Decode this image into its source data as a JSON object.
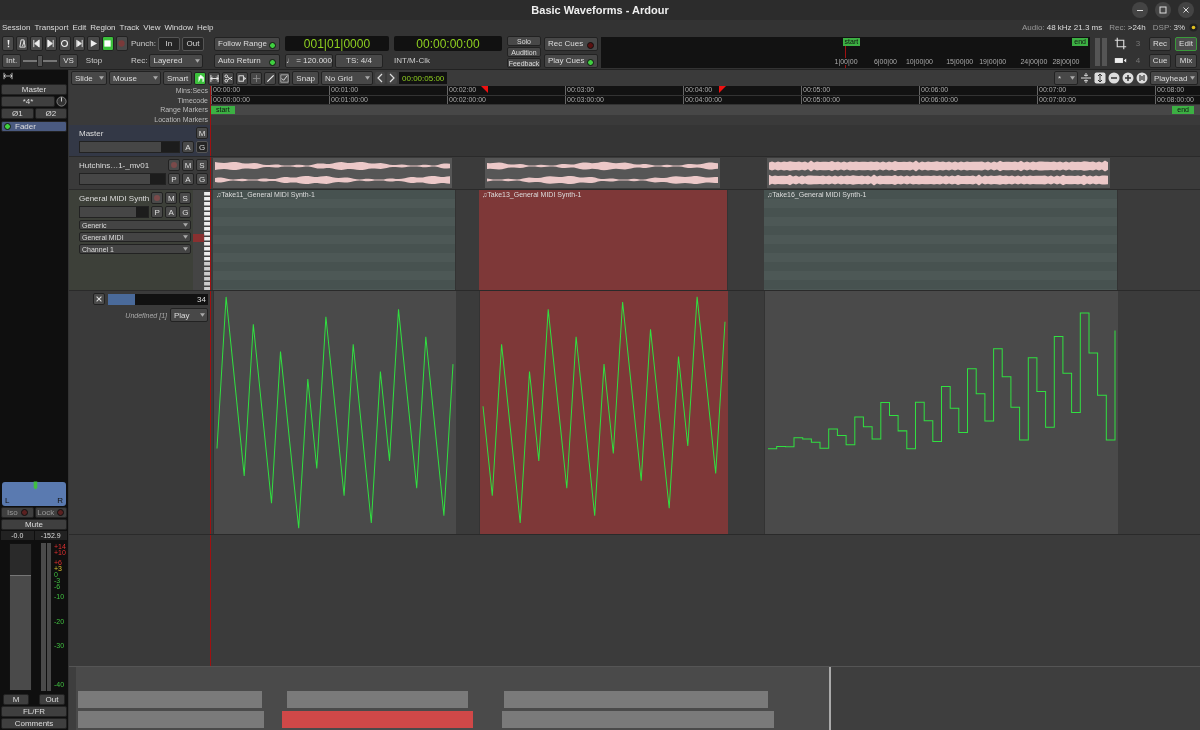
{
  "window": {
    "title": "Basic Waveforms - Ardour"
  },
  "menu": [
    "Session",
    "Transport",
    "Edit",
    "Region",
    "Track",
    "View",
    "Window",
    "Help"
  ],
  "status": [
    {
      "label": "Audio:",
      "value": "48 kHz 21.3 ms"
    },
    {
      "label": "Rec:",
      "value": ">24h"
    },
    {
      "label": "DSP:",
      "value": "3%"
    }
  ],
  "transport": {
    "buttons": [
      {
        "kind": "alert",
        "on": false
      },
      {
        "kind": "metronome",
        "on": false
      },
      {
        "kind": "start",
        "on": false
      },
      {
        "kind": "end",
        "on": false
      },
      {
        "kind": "loop",
        "on": false
      },
      {
        "kind": "range",
        "on": false
      },
      {
        "kind": "play",
        "on": false
      },
      {
        "kind": "stop",
        "on": true
      },
      {
        "kind": "record",
        "on": false
      }
    ],
    "punch_label": "Punch:",
    "punch": [
      {
        "label": "In",
        "disabled": true
      },
      {
        "label": "Out",
        "disabled": true
      }
    ],
    "int_button": "Int.",
    "shuttle": {
      "level": 0.5
    },
    "vs_button": "VS",
    "state": "Stop",
    "rec_label": "Rec:",
    "rec_mode": "Layered",
    "follow": [
      {
        "label": "Follow Range",
        "on": true
      },
      {
        "label": "Auto Return",
        "on": true
      }
    ],
    "primary_clock": "001|01|0000",
    "secondary_clock": "00:00:00:00",
    "tempo": "♩ = 120.000",
    "meter": "TS: 4/4",
    "sync": "INT/M-Clk",
    "monitor": [
      "Solo",
      "Audition",
      "Feedback"
    ],
    "cues": [
      {
        "label": "Rec Cues",
        "on": false
      },
      {
        "label": "Play Cues",
        "on": true
      }
    ],
    "mini_timeline": {
      "markers": [
        "start",
        "end"
      ],
      "ticks": [
        "1|00|00",
        "6|00|00",
        "10|00|00",
        "15|00|00",
        "19|00|00",
        "24|00|00",
        "28|00|00"
      ]
    },
    "counts": [
      "3",
      "4"
    ],
    "window_buttons": [
      {
        "label": "Rec",
        "selected": false
      },
      {
        "label": "Edit",
        "selected": true
      },
      {
        "label": "Cue",
        "selected": false
      },
      {
        "label": "Mix",
        "selected": false
      }
    ]
  },
  "edit_toolbar": {
    "edit_mode": "Slide",
    "ripple_mode": "Mouse",
    "smart": "Smart",
    "tools": [
      {
        "kind": "grab",
        "selected": true
      },
      {
        "kind": "range",
        "selected": false
      },
      {
        "kind": "cut",
        "selected": false
      },
      {
        "kind": "stretch",
        "selected": false
      },
      {
        "kind": "audition",
        "selected": false
      },
      {
        "kind": "draw",
        "selected": false
      },
      {
        "kind": "internal",
        "selected": false
      }
    ],
    "snap": "Snap",
    "grid": "No Grid",
    "nudge_clock": "00:00:05:00",
    "visible_tracks": "*",
    "zoom_focus": "Playhead"
  },
  "rulers": {
    "labels": [
      "Mins:Secs",
      "Timecode",
      "Range Markers",
      "Location Markers"
    ],
    "minsec": [
      "00:00:00",
      "00:01:00",
      "00:02:00",
      "00:03:00",
      "00:04:00",
      "00:05:00",
      "00:06:00",
      "00:07:00",
      "00:08:00"
    ],
    "timecode": [
      "00:00:00:00",
      "00:01:00:00",
      "00:02:00:00",
      "00:03:00:00",
      "00:04:00:00",
      "00:05:00:00",
      "00:06:00:00",
      "00:07:00:00",
      "00:08:00:00"
    ],
    "range_markers": [
      "start",
      "end"
    ]
  },
  "tracks": [
    {
      "kind": "master",
      "name": "Master",
      "level": 0.82,
      "buttons": [
        {
          "label": "M",
          "disabled": false
        },
        {
          "label": "A",
          "disabled": false
        },
        {
          "label": "G",
          "disabled": true
        }
      ]
    },
    {
      "kind": "audio",
      "name": "Hutchins…1-_mv01",
      "level": 0.82,
      "rec_enable": false,
      "buttons": [
        {
          "label": "M",
          "disabled": false
        },
        {
          "label": "S",
          "disabled": false
        },
        {
          "label": "P",
          "disabled": false
        },
        {
          "label": "A",
          "disabled": false
        },
        {
          "label": "G",
          "disabled": false
        }
      ],
      "regions": [
        {
          "selected": false
        },
        {
          "selected": false
        },
        {
          "selected": false
        }
      ]
    },
    {
      "kind": "midi",
      "name": "General MIDI Synth",
      "level": 0.82,
      "rec_enable": false,
      "buttons": [
        {
          "label": "M",
          "disabled": false
        },
        {
          "label": "S",
          "disabled": false
        },
        {
          "label": "P",
          "disabled": false
        },
        {
          "label": "A",
          "disabled": false
        },
        {
          "label": "G",
          "disabled": false
        }
      ],
      "selectors": [
        "Generic",
        "General MIDI",
        "Channel  1"
      ],
      "regions": [
        {
          "name": "♫Take11_General MIDI Synth-1",
          "selected": false
        },
        {
          "name": "♫Take13_General MIDI Synth-1",
          "selected": true
        },
        {
          "name": "♫Take16_General MIDI Synth-1",
          "selected": false
        }
      ],
      "automation": {
        "value": "34",
        "level": 0.27,
        "name": "Undefined [1]",
        "mode": "Play"
      }
    }
  ],
  "strip": {
    "name": "Master",
    "input": "*4*",
    "phase": [
      "Ø1",
      "Ø2"
    ],
    "tabs": [
      {
        "label": "Fader",
        "selected": true
      }
    ],
    "pan_left": "L",
    "pan_right": "R",
    "iso": "Iso",
    "lock": "Lock",
    "mute": "Mute",
    "gain": "-0.0",
    "peak": "-152.9",
    "fader": {
      "level": 0.78
    },
    "scale": [
      "+14",
      "+10",
      "+6",
      "+3",
      "0",
      "-3",
      "-6",
      "-10",
      "-20",
      "-30",
      "-40"
    ],
    "meter_point": "M",
    "output": "Out",
    "panner_type": "FL/FR",
    "comments": "Comments"
  }
}
